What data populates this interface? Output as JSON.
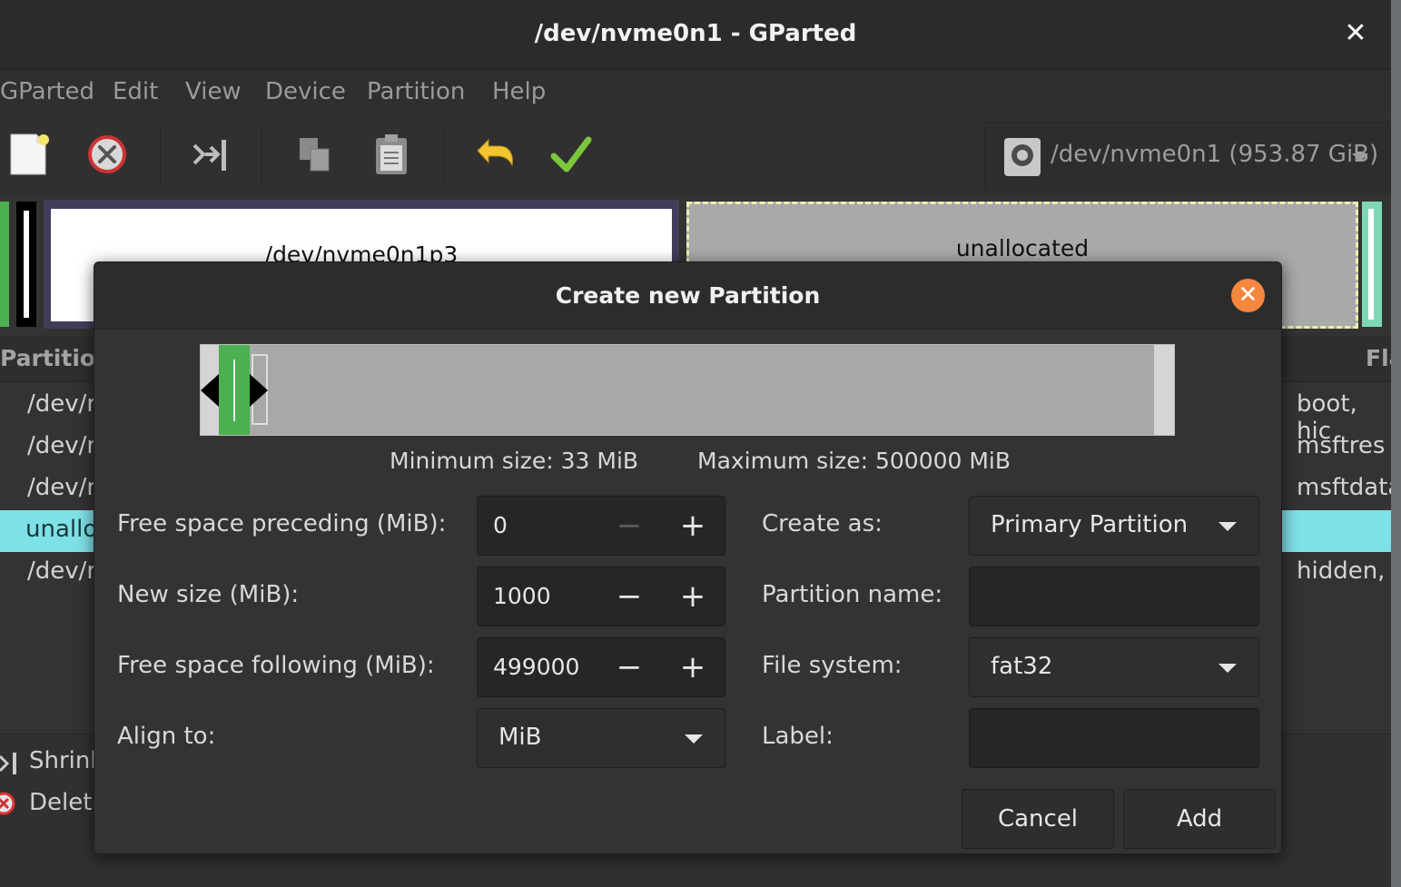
{
  "window": {
    "title": "/dev/nvme0n1 - GParted",
    "close_glyph": "✕"
  },
  "menu": [
    "GParted",
    "Edit",
    "View",
    "Device",
    "Partition",
    "Help"
  ],
  "toolbar": {
    "buttons": [
      "new-icon",
      "delete-icon",
      "resize-move-icon",
      "copy-icon",
      "paste-icon",
      "undo-icon",
      "apply-icon"
    ],
    "device": "/dev/nvme0n1 (953.87 GiB)"
  },
  "disk_map": {
    "partition": "/dev/nvme0n1p3",
    "unallocated": "unallocated"
  },
  "table": {
    "headers": {
      "partition": "Partition",
      "flags": "Fla"
    },
    "rows": [
      {
        "partition": "/dev/r",
        "flags": "boot, hic"
      },
      {
        "partition": "/dev/r",
        "flags": "msftres"
      },
      {
        "partition": "/dev/r",
        "flags": "msftdata"
      },
      {
        "partition": "unallo",
        "flags": ""
      },
      {
        "partition": "/dev/r",
        "flags": "hidden,"
      }
    ]
  },
  "pending": [
    {
      "label": "Shrink",
      "icon": "resize-move-icon"
    },
    {
      "label": "Delete",
      "icon": "delete-icon"
    }
  ],
  "dialog": {
    "title": "Create new Partition",
    "close_glyph": "✕",
    "size_fill_fraction": 0.002,
    "min_size": "Minimum size: 33 MiB",
    "max_size": "Maximum size: 500000 MiB",
    "labels": {
      "preceding": "Free space preceding (MiB):",
      "new_size": "New size (MiB):",
      "following": "Free space following (MiB):",
      "align": "Align to:",
      "create_as": "Create as:",
      "name": "Partition name:",
      "fs": "File system:",
      "label": "Label:"
    },
    "values": {
      "preceding": "0",
      "new_size": "1000",
      "following": "499000",
      "align": "MiB",
      "create_as": "Primary Partition",
      "name": "",
      "fs": "fat32",
      "label": ""
    },
    "spin_minus": "−",
    "spin_plus": "+",
    "buttons": {
      "cancel": "Cancel",
      "add": "Add"
    }
  }
}
